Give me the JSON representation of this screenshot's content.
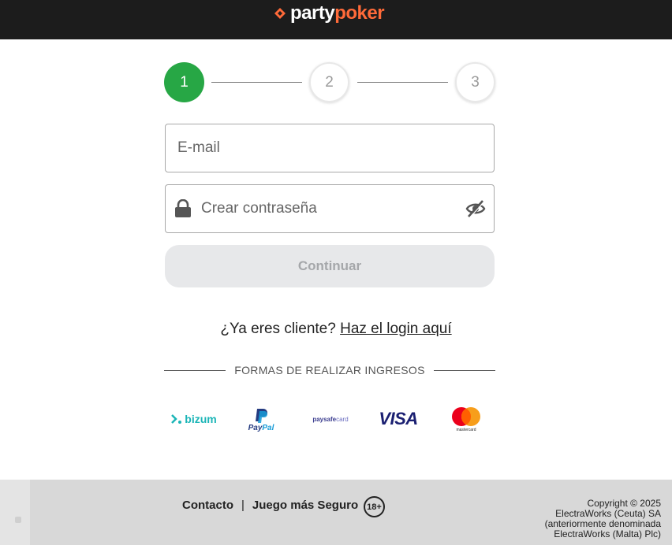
{
  "header": {
    "logo_part1": "party",
    "logo_part2": "poker",
    "brand_color": "#ff6a39",
    "bar_color": "#1c1c1c"
  },
  "stepper": {
    "steps": [
      "1",
      "2",
      "3"
    ],
    "current_step": 1,
    "active_color": "#27a745"
  },
  "form": {
    "email_placeholder": "E-mail",
    "email_value": "",
    "password_placeholder": "Crear contraseña",
    "password_value": "",
    "continue_label": "Continuar"
  },
  "login": {
    "prompt": "¿Ya eres cliente?",
    "link_label": "Haz el login aquí"
  },
  "payments": {
    "header": "FORMAS DE REALIZAR INGRESOS",
    "methods": {
      "bizum": "bizum",
      "paypal_top": "Pay",
      "paypal_bottom": "Pal",
      "paysafecard_part1": "paysafe",
      "paysafecard_part2": "card",
      "visa": "VISA",
      "mastercard": "mastercard"
    }
  },
  "footer": {
    "contact_label": "Contacto",
    "separator": "|",
    "safer_gambling_label": "Juego más Seguro",
    "age_badge": "18+",
    "copyright_lines": [
      "Copyright © 2025",
      "ElectraWorks (Ceuta) SA",
      "(anteriormente denominada",
      "ElectraWorks (Malta) Plc)"
    ]
  }
}
